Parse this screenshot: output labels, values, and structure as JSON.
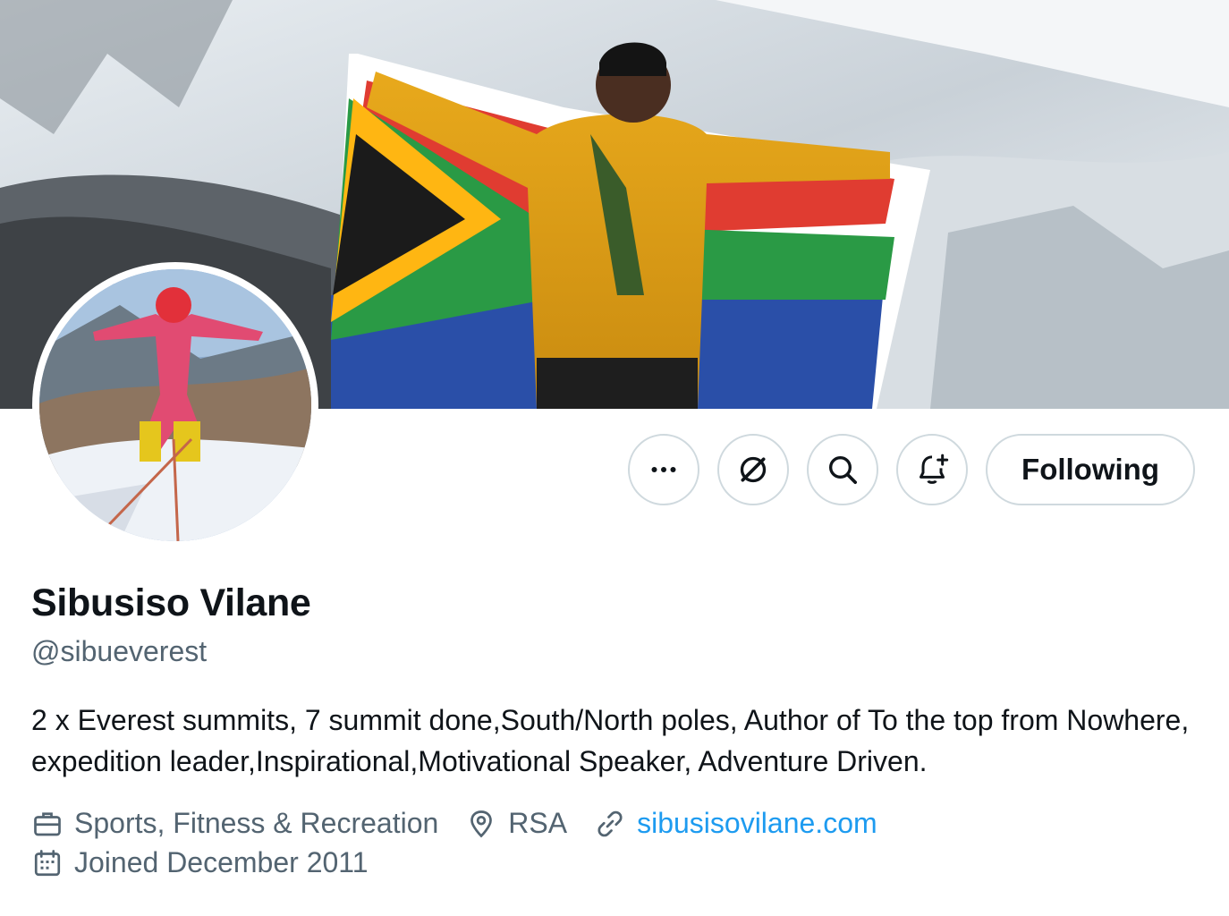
{
  "profile": {
    "name": "Sibusiso Vilane",
    "handle": "@sibueverest",
    "bio": "2 x Everest summits, 7 summit done,South/North poles, Author of To the top from Nowhere, expedition leader,Inspirational,Motivational Speaker, Adventure Driven.",
    "category": "Sports, Fitness & Recreation",
    "location": "RSA",
    "website": "sibusisovilane.com",
    "joined": "Joined December 2011"
  },
  "actions": {
    "more_icon": "more-icon",
    "grok_icon": "grok-icon",
    "search_icon": "search-icon",
    "notify_icon": "bell-plus-icon",
    "following_label": "Following"
  },
  "colors": {
    "link": "#1d9bf0",
    "secondary_text": "#536471",
    "primary_text": "#0f1419",
    "border": "#cfd9de"
  }
}
